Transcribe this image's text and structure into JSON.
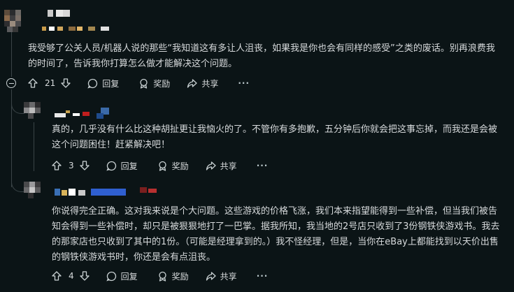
{
  "comments": [
    {
      "text": "我受够了公关人员/机器人说的那些“我知道这有多让人沮丧，如果我是你也会有同样的感受”之类的废话。别再浪费我的时间了，告诉我你打算怎么做才能解决这个问题。",
      "votes": "21",
      "reply_label": "回复",
      "award_label": "奖励",
      "share_label": "共享",
      "more_label": "···"
    },
    {
      "text": "真的，几乎没有什么比这种胡扯更让我恼火的了。不管你有多抱歉，五分钟后你就会把这事忘掉，而我还是会被这个问题困住！赶紧解决吧！",
      "votes": "3",
      "reply_label": "回复",
      "award_label": "奖励",
      "share_label": "共享",
      "more_label": "···"
    },
    {
      "text": "你说得完全正确。这对我来说是个大问题。这些游戏的价格飞涨，我们本来指望能得到一些补偿，但当我们被告知会得到一些补偿时，却只是被狠狠地打了一巴掌。据我所知，我当地的2号店只收到了3份钢铁侠游戏书。我去的那家店也只收到了其中的1份。（可能是经理拿到的。）我不怪经理，但是，当你在eBay上都能找到以天价出售的钢铁侠游戏书时，你还是会有点沮丧。",
      "votes": "4",
      "reply_label": "回复",
      "award_label": "奖励",
      "share_label": "共享",
      "more_label": "···"
    }
  ],
  "colors": {
    "background": "#0b1416",
    "text": "#d7dadc",
    "muted": "#b8c5c9",
    "thread_line": "#3a4447"
  },
  "icons": [
    "upvote-icon",
    "downvote-icon",
    "comment-icon",
    "award-icon",
    "share-icon",
    "more-icon",
    "collapse-icon"
  ]
}
